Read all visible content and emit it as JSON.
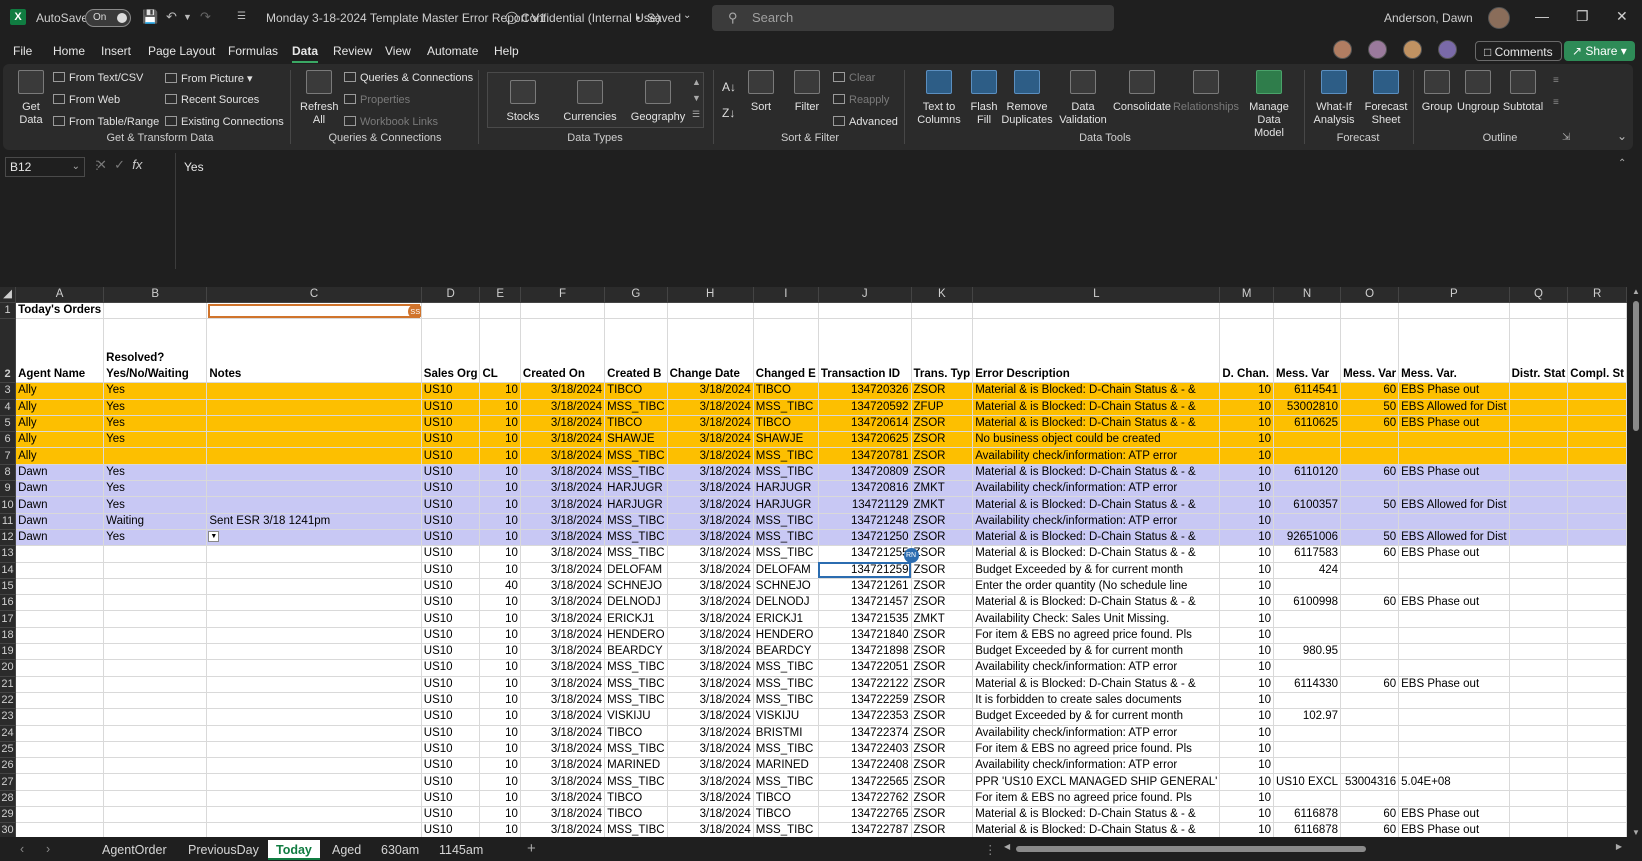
{
  "titlebar": {
    "autosave_label": "AutoSave",
    "autosave_state": "On",
    "doc_title": "Monday 3-18-2024 Template Master Error Report V1",
    "sensitivity": "Confidential (Internal Use)",
    "save_status": "Saved",
    "search_placeholder": "Search",
    "user_name": "Anderson, Dawn"
  },
  "menu": {
    "items": [
      "File",
      "Home",
      "Insert",
      "Page Layout",
      "Formulas",
      "Data",
      "Review",
      "View",
      "Automate",
      "Help"
    ],
    "active": "Data",
    "comments_label": "Comments",
    "share_label": "Share"
  },
  "ribbon": {
    "get_data": "Get Data",
    "from_text_csv": "From Text/CSV",
    "from_web": "From Web",
    "from_table_range": "From Table/Range",
    "from_picture": "From Picture",
    "recent_sources": "Recent Sources",
    "existing_connections": "Existing Connections",
    "group_get_transform": "Get & Transform Data",
    "refresh_all": "Refresh All",
    "queries_connections": "Queries & Connections",
    "properties": "Properties",
    "workbook_links": "Workbook Links",
    "group_queries": "Queries & Connections",
    "stocks": "Stocks",
    "currencies": "Currencies",
    "geography": "Geography",
    "group_data_types": "Data Types",
    "sort": "Sort",
    "filter": "Filter",
    "clear": "Clear",
    "reapply": "Reapply",
    "advanced": "Advanced",
    "group_sort_filter": "Sort & Filter",
    "text_to_columns": "Text to Columns",
    "flash_fill": "Flash Fill",
    "remove_duplicates": "Remove Duplicates",
    "data_validation": "Data Validation",
    "consolidate": "Consolidate",
    "relationships": "Relationships",
    "manage_data_model": "Manage Data Model",
    "group_data_tools": "Data Tools",
    "what_if": "What-If Analysis",
    "forecast_sheet": "Forecast Sheet",
    "group_forecast": "Forecast",
    "group_btn": "Group",
    "ungroup_btn": "Ungroup",
    "subtotal": "Subtotal",
    "group_outline": "Outline"
  },
  "formula_bar": {
    "name_box": "B12",
    "formula": "Yes"
  },
  "columns": [
    "A",
    "B",
    "C",
    "D",
    "E",
    "F",
    "G",
    "H",
    "I",
    "J",
    "K",
    "L",
    "M",
    "N",
    "O",
    "P",
    "Q",
    "R"
  ],
  "comment_marker": "SS",
  "presence_marker": "RN",
  "row1": {
    "a": "Today's Orders"
  },
  "headers": {
    "a": "Agent Name",
    "b1": "Resolved?",
    "b2": "Yes/No/Waiting",
    "c": "Notes",
    "d": "Sales Org",
    "e": "CL",
    "f": "Created On",
    "g": "Created B",
    "h": "Change Date",
    "i": "Changed E",
    "j": "Transaction ID",
    "k": "Trans. Typ",
    "l": "Error Description",
    "m": "D. Chan.",
    "n": "Mess. Var",
    "o": "Mess. Var",
    "p": "Mess. Var.",
    "q": "Distr. Stat",
    "r": "Compl. St"
  },
  "rows": [
    {
      "n": "3",
      "cls": "ally",
      "a": "Ally",
      "b": "Yes",
      "c": "",
      "d": "US10",
      "e": "10",
      "f": "3/18/2024",
      "g": "TIBCO",
      "h": "3/18/2024",
      "i": "TIBCO",
      "j": "134720326",
      "k": "ZSOR",
      "l": "Material & is Blocked: D-Chain Status & - &",
      "m": "10",
      "n2": "6114541",
      "o": "60",
      "p": "EBS Phase out"
    },
    {
      "n": "4",
      "cls": "ally",
      "a": "Ally",
      "b": "Yes",
      "c": "",
      "d": "US10",
      "e": "10",
      "f": "3/18/2024",
      "g": "MSS_TIBC",
      "h": "3/18/2024",
      "i": "MSS_TIBC",
      "j": "134720592",
      "k": "ZFUP",
      "l": "Material & is Blocked: D-Chain Status & - &",
      "m": "10",
      "n2": "53002810",
      "o": "50",
      "p": "EBS Allowed for Dist"
    },
    {
      "n": "5",
      "cls": "ally",
      "a": "Ally",
      "b": "Yes",
      "c": "",
      "d": "US10",
      "e": "10",
      "f": "3/18/2024",
      "g": "TIBCO",
      "h": "3/18/2024",
      "i": "TIBCO",
      "j": "134720614",
      "k": "ZSOR",
      "l": "Material & is Blocked: D-Chain Status & - &",
      "m": "10",
      "n2": "6110625",
      "o": "60",
      "p": "EBS Phase out"
    },
    {
      "n": "6",
      "cls": "ally",
      "a": "Ally",
      "b": "Yes",
      "c": "",
      "d": "US10",
      "e": "10",
      "f": "3/18/2024",
      "g": "SHAWJE",
      "h": "3/18/2024",
      "i": "SHAWJE",
      "j": "134720625",
      "k": "ZSOR",
      "l": "No business object could be created",
      "m": "10",
      "n2": "",
      "o": "",
      "p": ""
    },
    {
      "n": "7",
      "cls": "ally",
      "a": "Ally",
      "b": "",
      "c": "",
      "d": "US10",
      "e": "10",
      "f": "3/18/2024",
      "g": "MSS_TIBC",
      "h": "3/18/2024",
      "i": "MSS_TIBC",
      "j": "134720781",
      "k": "ZSOR",
      "l": "Availability check/information: ATP error",
      "m": "10",
      "n2": "",
      "o": "",
      "p": ""
    },
    {
      "n": "8",
      "cls": "dawn",
      "a": "Dawn",
      "b": "Yes",
      "c": "",
      "d": "US10",
      "e": "10",
      "f": "3/18/2024",
      "g": "MSS_TIBC",
      "h": "3/18/2024",
      "i": "MSS_TIBC",
      "j": "134720809",
      "k": "ZSOR",
      "l": "Material & is Blocked: D-Chain Status & - &",
      "m": "10",
      "n2": "6110120",
      "o": "60",
      "p": "EBS Phase out"
    },
    {
      "n": "9",
      "cls": "dawn",
      "a": "Dawn",
      "b": "Yes",
      "c": "",
      "d": "US10",
      "e": "10",
      "f": "3/18/2024",
      "g": "HARJUGR",
      "h": "3/18/2024",
      "i": "HARJUGR",
      "j": "134720816",
      "k": "ZMKT",
      "l": "Availability check/information: ATP error",
      "m": "10",
      "n2": "",
      "o": "",
      "p": ""
    },
    {
      "n": "10",
      "cls": "dawn",
      "a": "Dawn",
      "b": "Yes",
      "c": "",
      "d": "US10",
      "e": "10",
      "f": "3/18/2024",
      "g": "HARJUGR",
      "h": "3/18/2024",
      "i": "HARJUGR",
      "j": "134721129",
      "k": "ZMKT",
      "l": "Material & is Blocked: D-Chain Status & - &",
      "m": "10",
      "n2": "6100357",
      "o": "50",
      "p": "EBS Allowed for Dist"
    },
    {
      "n": "11",
      "cls": "dawn",
      "a": "Dawn",
      "b": "Waiting",
      "c": "Sent ESR 3/18 1241pm",
      "d": "US10",
      "e": "10",
      "f": "3/18/2024",
      "g": "MSS_TIBC",
      "h": "3/18/2024",
      "i": "MSS_TIBC",
      "j": "134721248",
      "k": "ZSOR",
      "l": "Availability check/information: ATP error",
      "m": "10",
      "n2": "",
      "o": "",
      "p": ""
    },
    {
      "n": "12",
      "cls": "dawn",
      "a": "Dawn",
      "b": "Yes",
      "c": "",
      "d": "US10",
      "e": "10",
      "f": "3/18/2024",
      "g": "MSS_TIBC",
      "h": "3/18/2024",
      "i": "MSS_TIBC",
      "j": "134721250",
      "k": "ZSOR",
      "l": "Material & is Blocked: D-Chain Status & - &",
      "m": "10",
      "n2": "92651006",
      "o": "50",
      "p": "EBS Allowed for Dist"
    },
    {
      "n": "13",
      "cls": "",
      "a": "",
      "b": "",
      "c": "",
      "d": "US10",
      "e": "10",
      "f": "3/18/2024",
      "g": "MSS_TIBC",
      "h": "3/18/2024",
      "i": "MSS_TIBC",
      "j": "134721255",
      "k": "ZSOR",
      "l": "Material & is Blocked: D-Chain Status & - &",
      "m": "10",
      "n2": "6117583",
      "o": "60",
      "p": "EBS Phase out"
    },
    {
      "n": "14",
      "cls": "",
      "a": "",
      "b": "",
      "c": "",
      "d": "US10",
      "e": "10",
      "f": "3/18/2024",
      "g": "DELOFAM",
      "h": "3/18/2024",
      "i": "DELOFAM",
      "j": "134721259",
      "k": "ZSOR",
      "l": "Budget Exceeded by & for current month",
      "m": "10",
      "n2": "424",
      "o": "",
      "p": ""
    },
    {
      "n": "15",
      "cls": "",
      "a": "",
      "b": "",
      "c": "",
      "d": "US10",
      "e": "40",
      "f": "3/18/2024",
      "g": "SCHNEJO",
      "h": "3/18/2024",
      "i": "SCHNEJO",
      "j": "134721261",
      "k": "ZSOR",
      "l": "Enter the order quantity (No schedule line",
      "m": "10",
      "n2": "",
      "o": "",
      "p": ""
    },
    {
      "n": "16",
      "cls": "",
      "a": "",
      "b": "",
      "c": "",
      "d": "US10",
      "e": "10",
      "f": "3/18/2024",
      "g": "DELNODJ",
      "h": "3/18/2024",
      "i": "DELNODJ",
      "j": "134721457",
      "k": "ZSOR",
      "l": "Material & is Blocked: D-Chain Status & - &",
      "m": "10",
      "n2": "6100998",
      "o": "60",
      "p": "EBS Phase out"
    },
    {
      "n": "17",
      "cls": "",
      "a": "",
      "b": "",
      "c": "",
      "d": "US10",
      "e": "10",
      "f": "3/18/2024",
      "g": "ERICKJ1",
      "h": "3/18/2024",
      "i": "ERICKJ1",
      "j": "134721535",
      "k": "ZMKT",
      "l": "Availability Check: Sales Unit Missing.",
      "m": "10",
      "n2": "",
      "o": "",
      "p": ""
    },
    {
      "n": "18",
      "cls": "",
      "a": "",
      "b": "",
      "c": "",
      "d": "US10",
      "e": "10",
      "f": "3/18/2024",
      "g": "HENDERO",
      "h": "3/18/2024",
      "i": "HENDERO",
      "j": "134721840",
      "k": "ZSOR",
      "l": "For item & EBS no agreed price found. Pls",
      "m": "10",
      "n2": "",
      "o": "",
      "p": ""
    },
    {
      "n": "19",
      "cls": "",
      "a": "",
      "b": "",
      "c": "",
      "d": "US10",
      "e": "10",
      "f": "3/18/2024",
      "g": "BEARDCY",
      "h": "3/18/2024",
      "i": "BEARDCY",
      "j": "134721898",
      "k": "ZSOR",
      "l": "Budget Exceeded by & for current month",
      "m": "10",
      "n2": "980.95",
      "o": "",
      "p": ""
    },
    {
      "n": "20",
      "cls": "",
      "a": "",
      "b": "",
      "c": "",
      "d": "US10",
      "e": "10",
      "f": "3/18/2024",
      "g": "MSS_TIBC",
      "h": "3/18/2024",
      "i": "MSS_TIBC",
      "j": "134722051",
      "k": "ZSOR",
      "l": "Availability check/information: ATP error",
      "m": "10",
      "n2": "",
      "o": "",
      "p": ""
    },
    {
      "n": "21",
      "cls": "",
      "a": "",
      "b": "",
      "c": "",
      "d": "US10",
      "e": "10",
      "f": "3/18/2024",
      "g": "MSS_TIBC",
      "h": "3/18/2024",
      "i": "MSS_TIBC",
      "j": "134722122",
      "k": "ZSOR",
      "l": "Material & is Blocked: D-Chain Status & - &",
      "m": "10",
      "n2": "6114330",
      "o": "60",
      "p": "EBS Phase out"
    },
    {
      "n": "22",
      "cls": "",
      "a": "",
      "b": "",
      "c": "",
      "d": "US10",
      "e": "10",
      "f": "3/18/2024",
      "g": "MSS_TIBC",
      "h": "3/18/2024",
      "i": "MSS_TIBC",
      "j": "134722259",
      "k": "ZSOR",
      "l": "It is forbidden to create sales documents",
      "m": "10",
      "n2": "",
      "o": "",
      "p": ""
    },
    {
      "n": "23",
      "cls": "",
      "a": "",
      "b": "",
      "c": "",
      "d": "US10",
      "e": "10",
      "f": "3/18/2024",
      "g": "VISKIJU",
      "h": "3/18/2024",
      "i": "VISKIJU",
      "j": "134722353",
      "k": "ZSOR",
      "l": "Budget Exceeded by & for current month",
      "m": "10",
      "n2": "102.97",
      "o": "",
      "p": ""
    },
    {
      "n": "24",
      "cls": "",
      "a": "",
      "b": "",
      "c": "",
      "d": "US10",
      "e": "10",
      "f": "3/18/2024",
      "g": "TIBCO",
      "h": "3/18/2024",
      "i": "BRISTMI",
      "j": "134722374",
      "k": "ZSOR",
      "l": "Availability check/information: ATP error",
      "m": "10",
      "n2": "",
      "o": "",
      "p": ""
    },
    {
      "n": "25",
      "cls": "",
      "a": "",
      "b": "",
      "c": "",
      "d": "US10",
      "e": "10",
      "f": "3/18/2024",
      "g": "MSS_TIBC",
      "h": "3/18/2024",
      "i": "MSS_TIBC",
      "j": "134722403",
      "k": "ZSOR",
      "l": "For item & EBS no agreed price found. Pls",
      "m": "10",
      "n2": "",
      "o": "",
      "p": ""
    },
    {
      "n": "26",
      "cls": "",
      "a": "",
      "b": "",
      "c": "",
      "d": "US10",
      "e": "10",
      "f": "3/18/2024",
      "g": "MARINED",
      "h": "3/18/2024",
      "i": "MARINED",
      "j": "134722408",
      "k": "ZSOR",
      "l": "Availability check/information: ATP error",
      "m": "10",
      "n2": "",
      "o": "",
      "p": ""
    },
    {
      "n": "27",
      "cls": "",
      "a": "",
      "b": "",
      "c": "",
      "d": "US10",
      "e": "10",
      "f": "3/18/2024",
      "g": "MSS_TIBC",
      "h": "3/18/2024",
      "i": "MSS_TIBC",
      "j": "134722565",
      "k": "ZSOR",
      "l": "PPR 'US10 EXCL MANAGED SHIP GENERAL'",
      "m": "10",
      "n2": "US10 EXCL",
      "o": "53004316",
      "p": "5.04E+08"
    },
    {
      "n": "28",
      "cls": "",
      "a": "",
      "b": "",
      "c": "",
      "d": "US10",
      "e": "10",
      "f": "3/18/2024",
      "g": "TIBCO",
      "h": "3/18/2024",
      "i": "TIBCO",
      "j": "134722762",
      "k": "ZSOR",
      "l": "For item & EBS no agreed price found. Pls",
      "m": "10",
      "n2": "",
      "o": "",
      "p": ""
    },
    {
      "n": "29",
      "cls": "",
      "a": "",
      "b": "",
      "c": "",
      "d": "US10",
      "e": "10",
      "f": "3/18/2024",
      "g": "TIBCO",
      "h": "3/18/2024",
      "i": "TIBCO",
      "j": "134722765",
      "k": "ZSOR",
      "l": "Material & is Blocked: D-Chain Status & - &",
      "m": "10",
      "n2": "6116878",
      "o": "60",
      "p": "EBS Phase out"
    },
    {
      "n": "30",
      "cls": "",
      "a": "",
      "b": "",
      "c": "",
      "d": "US10",
      "e": "10",
      "f": "3/18/2024",
      "g": "MSS_TIBC",
      "h": "3/18/2024",
      "i": "MSS_TIBC",
      "j": "134722787",
      "k": "ZSOR",
      "l": "Material & is Blocked: D-Chain Status & - &",
      "m": "10",
      "n2": "6116878",
      "o": "60",
      "p": "EBS Phase out"
    }
  ],
  "sheet_tabs": [
    "AgentOrder",
    "PreviousDay",
    "Today",
    "Aged",
    "630am",
    "1145am"
  ],
  "active_sheet": "Today",
  "colors": {
    "ally_row": "#fdbf00",
    "dawn_row": "#c8c8f4",
    "accent": "#107c41"
  }
}
